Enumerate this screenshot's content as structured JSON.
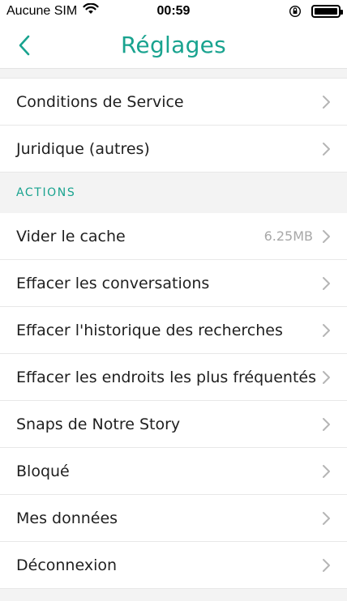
{
  "status_bar": {
    "carrier": "Aucune SIM",
    "time": "00:59"
  },
  "nav": {
    "title": "Réglages"
  },
  "rows_top": [
    {
      "label": "Conditions de Service"
    },
    {
      "label": "Juridique (autres)"
    }
  ],
  "section": {
    "title": "ACTIONS"
  },
  "rows_actions": [
    {
      "label": "Vider le cache",
      "value": "6.25MB"
    },
    {
      "label": "Effacer les conversations"
    },
    {
      "label": "Effacer l'historique des recherches"
    },
    {
      "label": "Effacer les endroits les plus fréquentés"
    },
    {
      "label": "Snaps de Notre Story"
    },
    {
      "label": "Bloqué"
    },
    {
      "label": "Mes données"
    },
    {
      "label": "Déconnexion"
    }
  ],
  "colors": {
    "accent": "#19a38f",
    "section_bg": "#f3f3f3",
    "separator": "#e8e8e8",
    "chevron": "#b5b5b5"
  }
}
